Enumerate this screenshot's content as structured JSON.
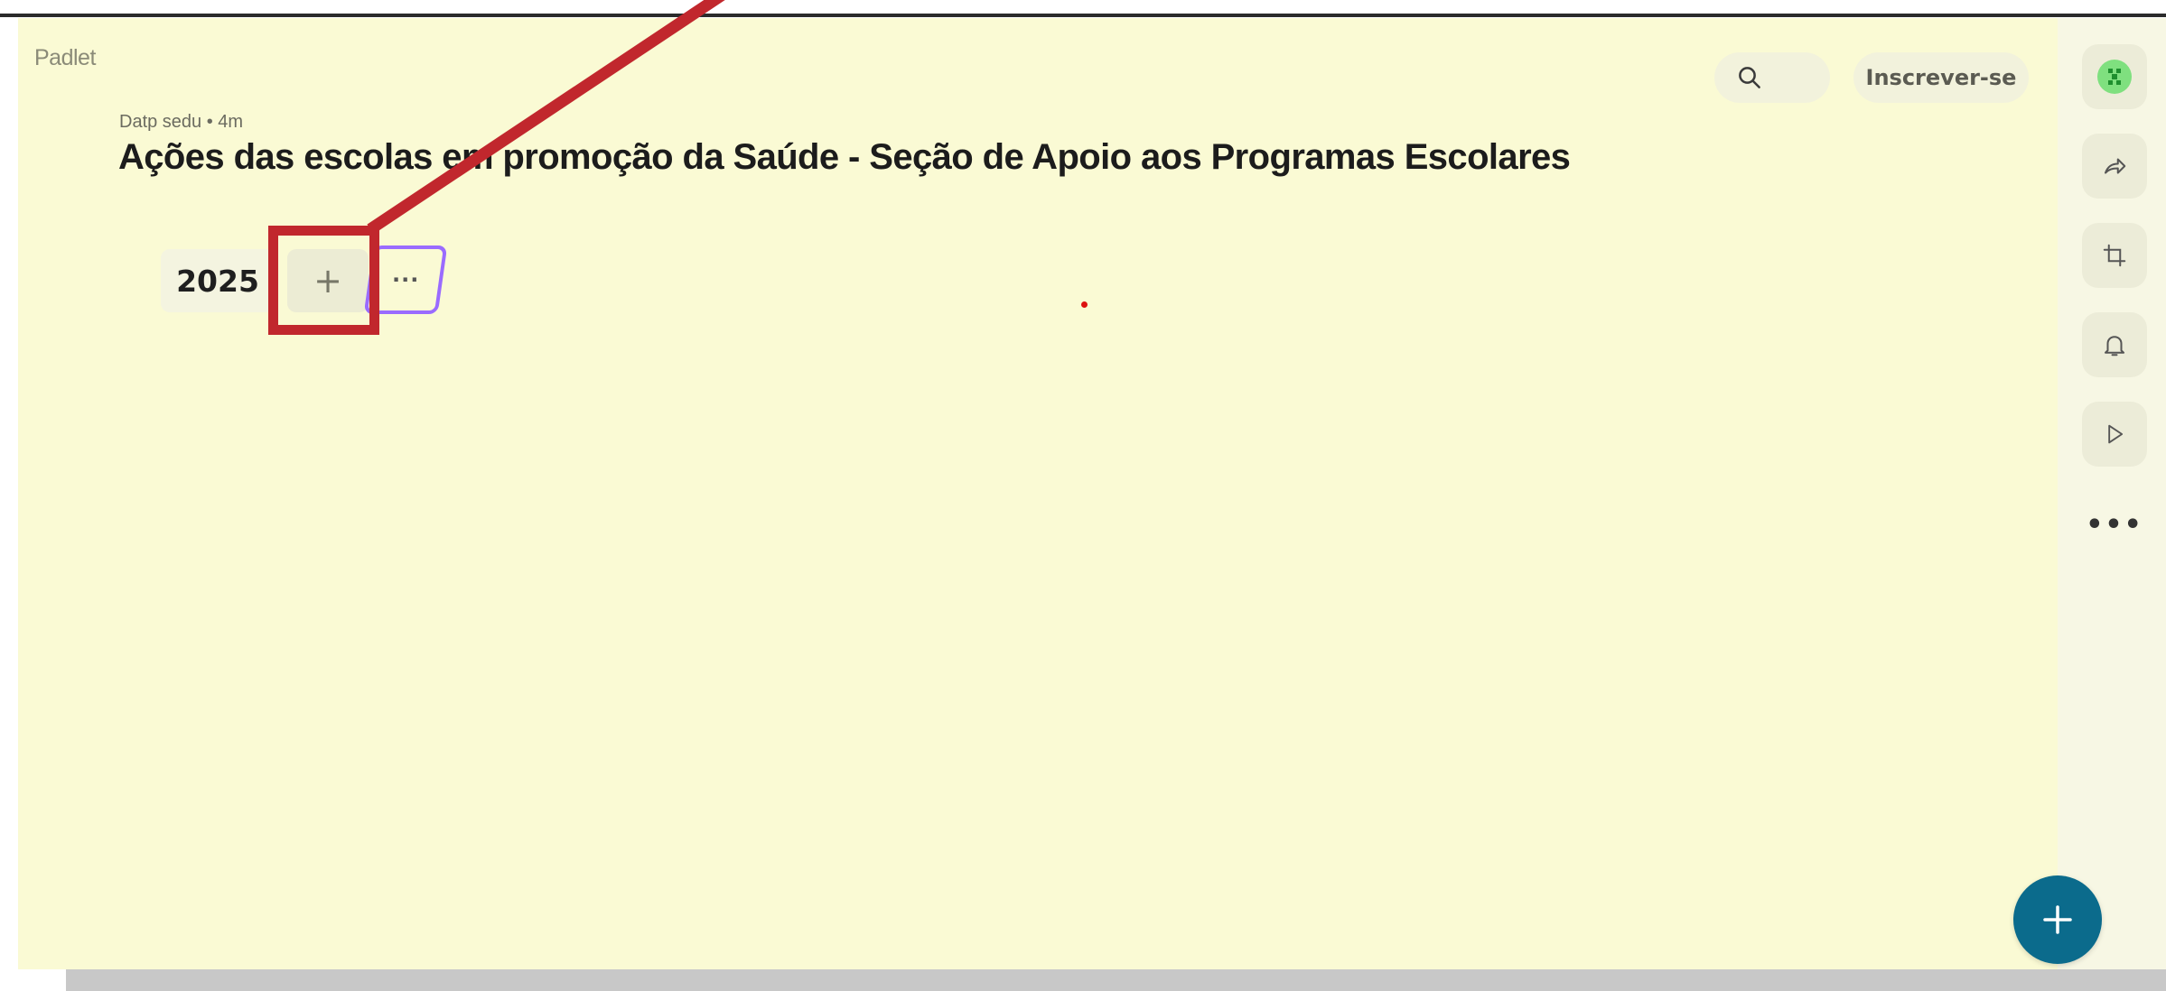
{
  "app": {
    "logo": "Padlet"
  },
  "header": {
    "subscribe_label": "Inscrever-se",
    "search_icon": "search-icon"
  },
  "board": {
    "meta": "Datp sedu • 4m",
    "title": "Ações das escolas em promoção da Saúde - Seção de Apoio aos Programas Escolares",
    "background_color": "#fafad4"
  },
  "sections": {
    "current_label": "2025",
    "add_symbol": "+",
    "more_symbol": "···"
  },
  "sidebar": {
    "buttons": [
      {
        "icon": "avatar-icon"
      },
      {
        "icon": "share-icon"
      },
      {
        "icon": "remake-icon"
      },
      {
        "icon": "bell-icon"
      },
      {
        "icon": "play-icon"
      }
    ],
    "more_symbol": "•••"
  },
  "fab": {
    "icon": "plus-icon",
    "color": "#0b6b8c"
  },
  "annotation": {
    "color": "#c1272d"
  }
}
